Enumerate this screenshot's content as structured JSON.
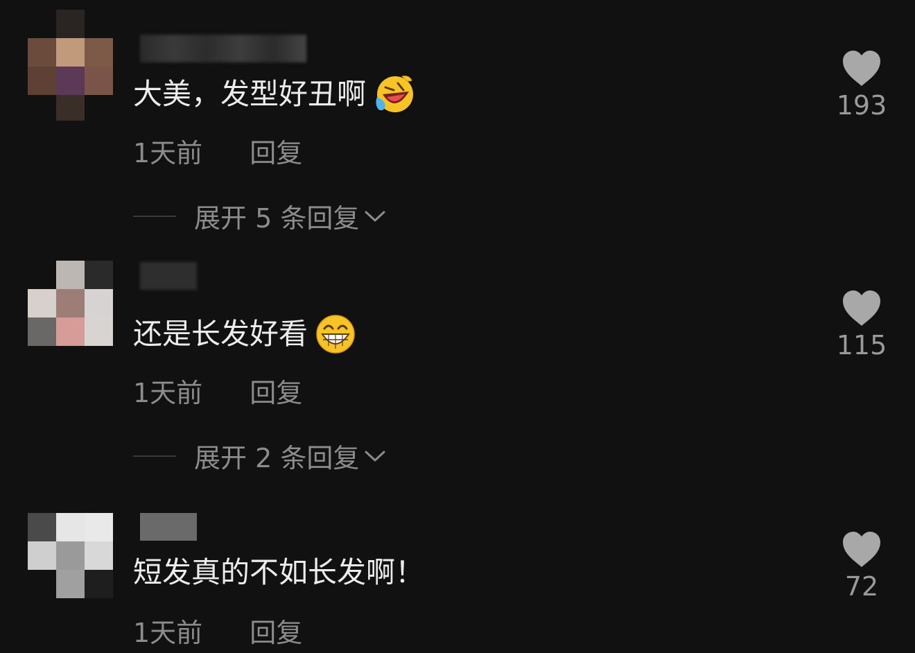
{
  "comments": [
    {
      "text": "大美，发型好丑啊",
      "emoji": "laughing-crying-emoji",
      "time": "1天前",
      "reply_label": "回复",
      "expand_label": "展开 5 条回复",
      "likes": "193"
    },
    {
      "text": "还是长发好看",
      "emoji": "grinning-emoji",
      "time": "1天前",
      "reply_label": "回复",
      "expand_label": "展开 2 条回复",
      "likes": "115"
    },
    {
      "text": "短发真的不如长发啊！",
      "time": "1天前",
      "reply_label": "回复",
      "likes": "72"
    }
  ],
  "colors": {
    "background": "#111112",
    "text": "#ececec",
    "muted": "#8c8c8c",
    "like": "#9a9a9a"
  }
}
